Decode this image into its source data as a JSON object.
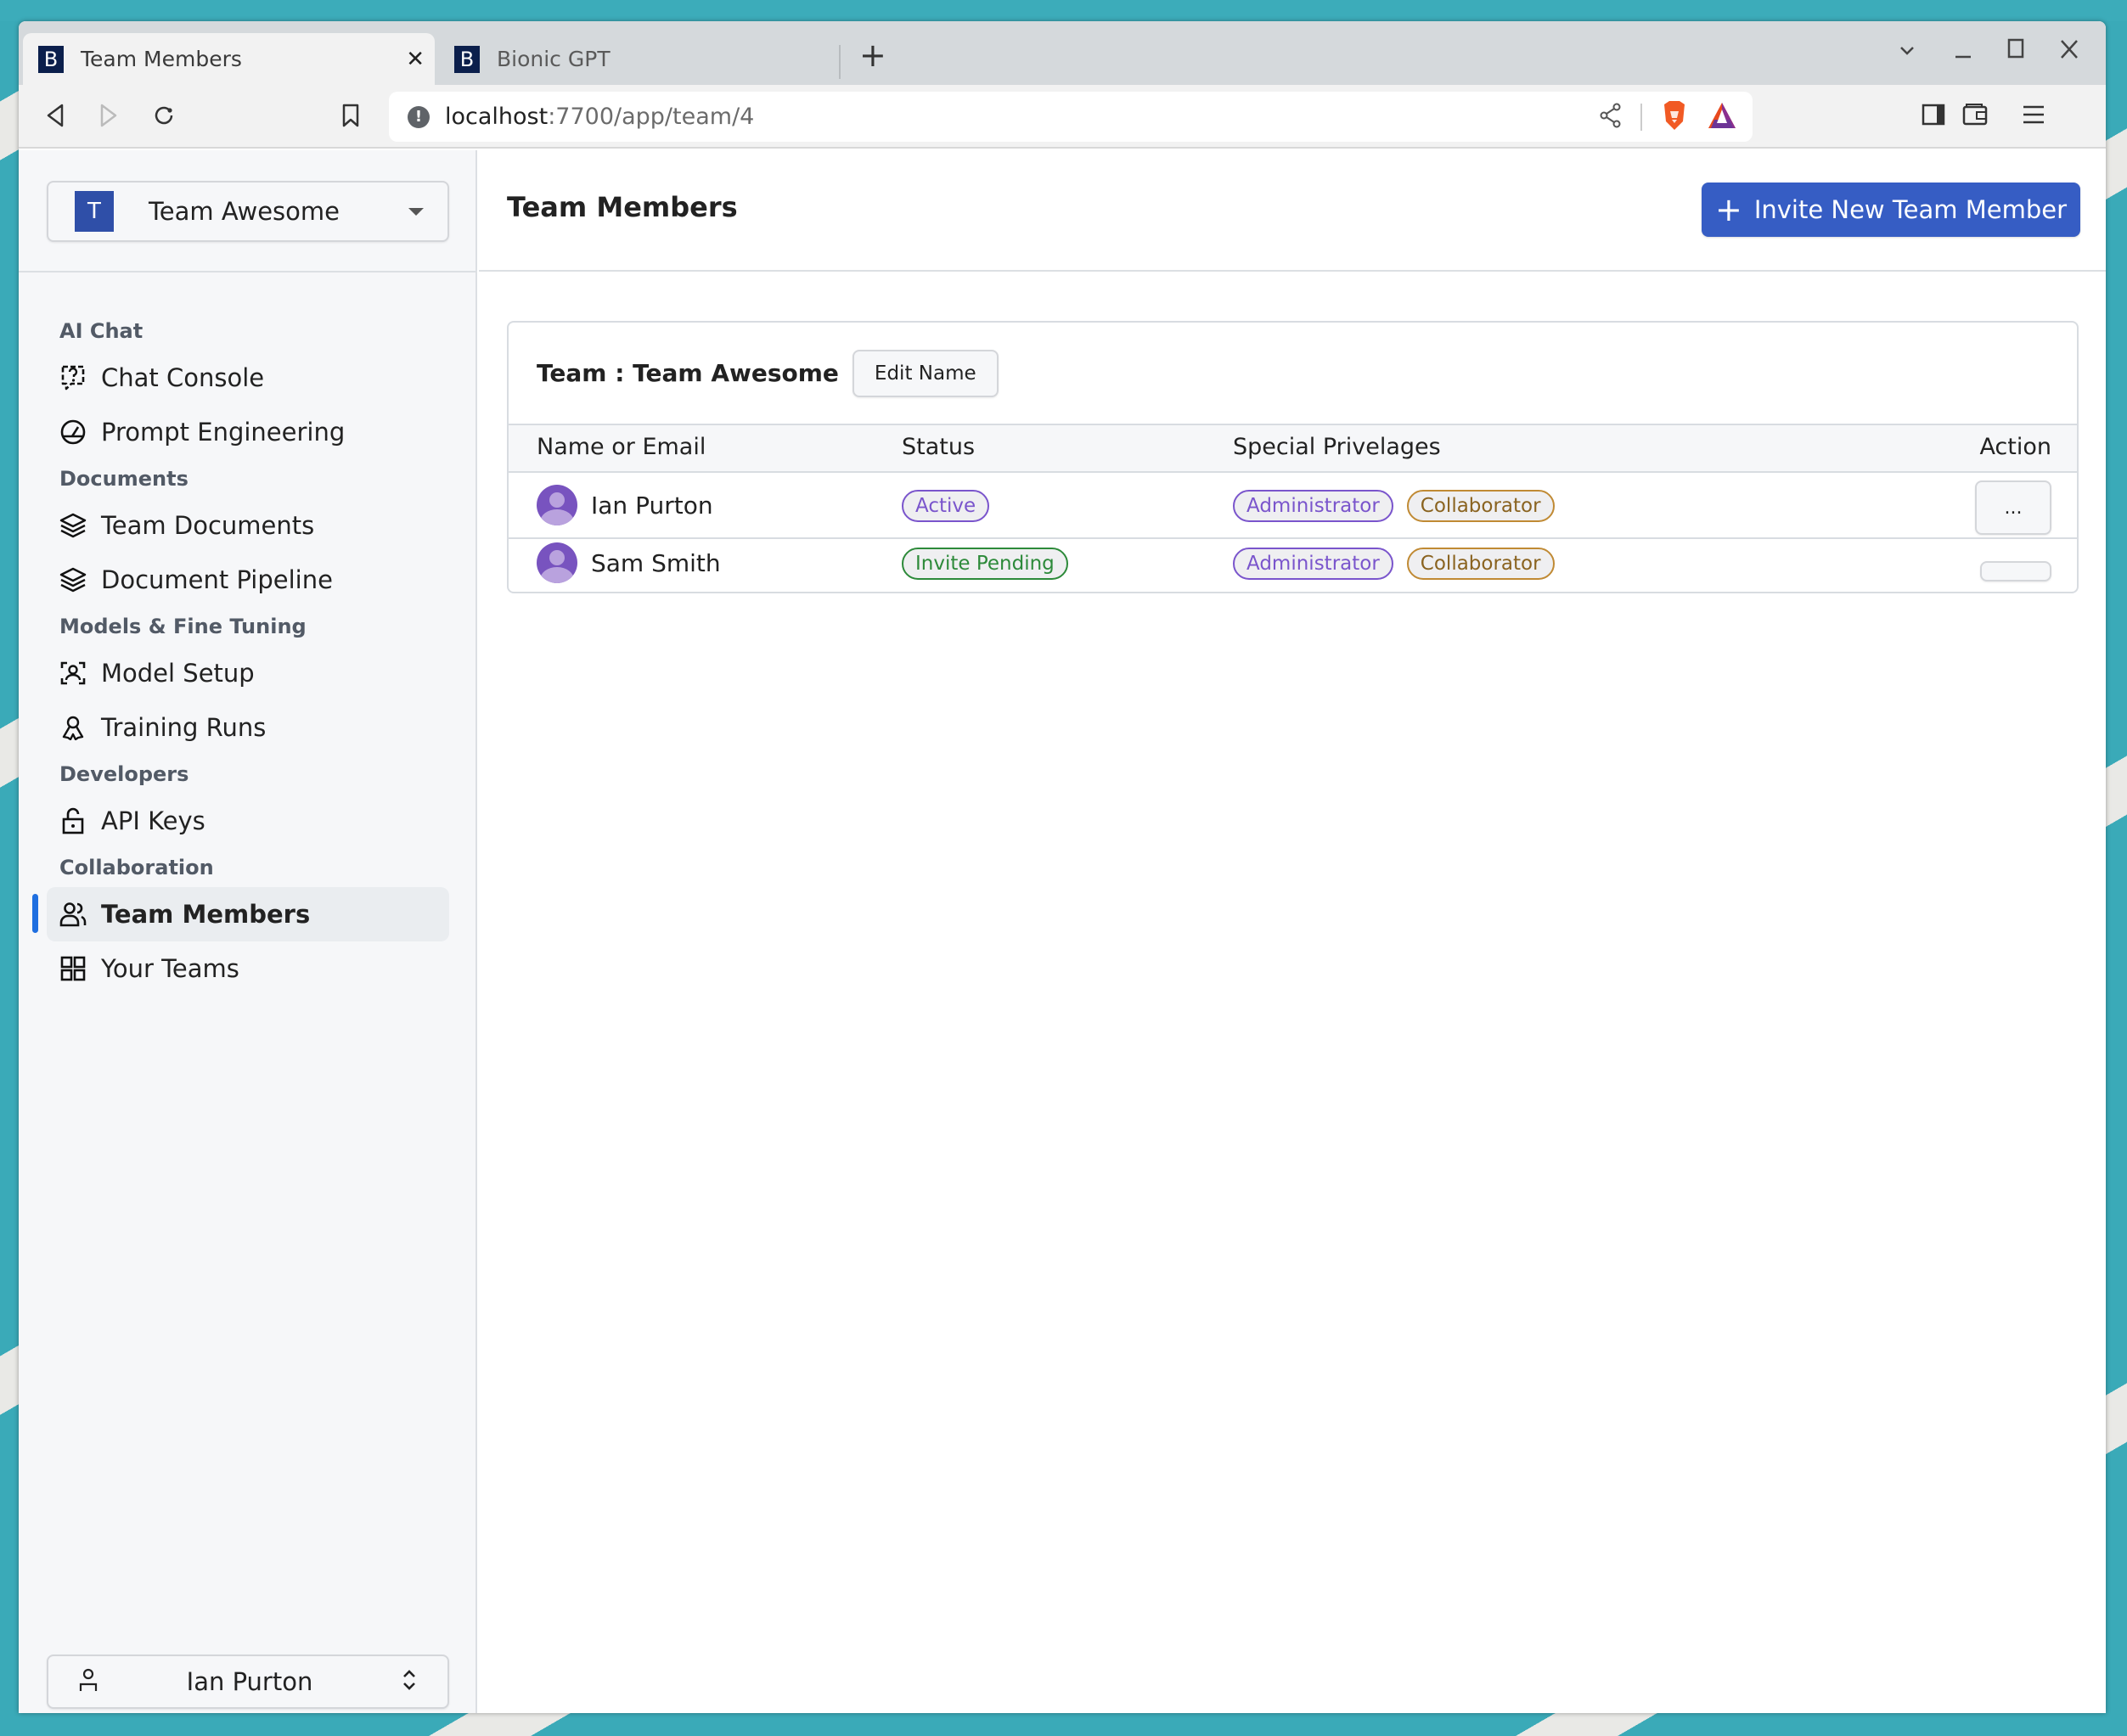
{
  "browser": {
    "tabs": [
      {
        "favicon": "B",
        "title": "Team Members",
        "active": true
      },
      {
        "favicon": "B",
        "title": "Bionic GPT",
        "active": false
      }
    ],
    "new_tab_label": "+",
    "url_host": "localhost",
    "url_rest": ":7700/app/team/4",
    "window_controls": [
      "chevron-down",
      "minimize",
      "maximize",
      "close"
    ]
  },
  "sidebar": {
    "team_switcher": {
      "initial": "T",
      "name": "Team Awesome"
    },
    "sections": [
      {
        "title": "AI Chat",
        "items": [
          {
            "label": "Chat Console",
            "icon": "chat-question-icon"
          },
          {
            "label": "Prompt Engineering",
            "icon": "gauge-icon"
          }
        ]
      },
      {
        "title": "Documents",
        "items": [
          {
            "label": "Team Documents",
            "icon": "layers-icon"
          },
          {
            "label": "Document Pipeline",
            "icon": "layers-icon"
          }
        ]
      },
      {
        "title": "Models & Fine Tuning",
        "items": [
          {
            "label": "Model Setup",
            "icon": "face-scan-icon"
          },
          {
            "label": "Training Runs",
            "icon": "ribbon-icon"
          }
        ]
      },
      {
        "title": "Developers",
        "items": [
          {
            "label": "API Keys",
            "icon": "unlock-icon"
          }
        ]
      },
      {
        "title": "Collaboration",
        "items": [
          {
            "label": "Team Members",
            "icon": "users-icon",
            "active": true
          },
          {
            "label": "Your Teams",
            "icon": "grid-icon"
          }
        ]
      }
    ],
    "user_switcher": {
      "name": "Ian Purton"
    }
  },
  "main": {
    "title": "Team Members",
    "invite_button": "Invite New Team Member",
    "card": {
      "title": "Team : Team Awesome",
      "edit_button": "Edit Name",
      "columns": [
        "Name or Email",
        "Status",
        "Special Privelages",
        "Action"
      ],
      "rows": [
        {
          "name": "Ian Purton",
          "status": "Active",
          "status_color": "purple",
          "privileges": [
            "Administrator",
            "Collaborator"
          ],
          "action": "..."
        },
        {
          "name": "Sam Smith",
          "status": "Invite Pending",
          "status_color": "green",
          "privileges": [
            "Administrator",
            "Collaborator"
          ],
          "action": ""
        }
      ]
    }
  },
  "colors": {
    "accent": "#365dc4",
    "active_indicator": "#1f6fe0",
    "team_avatar": "#2f4fa8",
    "favicon_bg": "#0b1f4c",
    "badge_purple": "#7a55cc",
    "badge_green": "#2d8a3a",
    "badge_gold": "#c08a34",
    "avatar": "#7853bf"
  }
}
